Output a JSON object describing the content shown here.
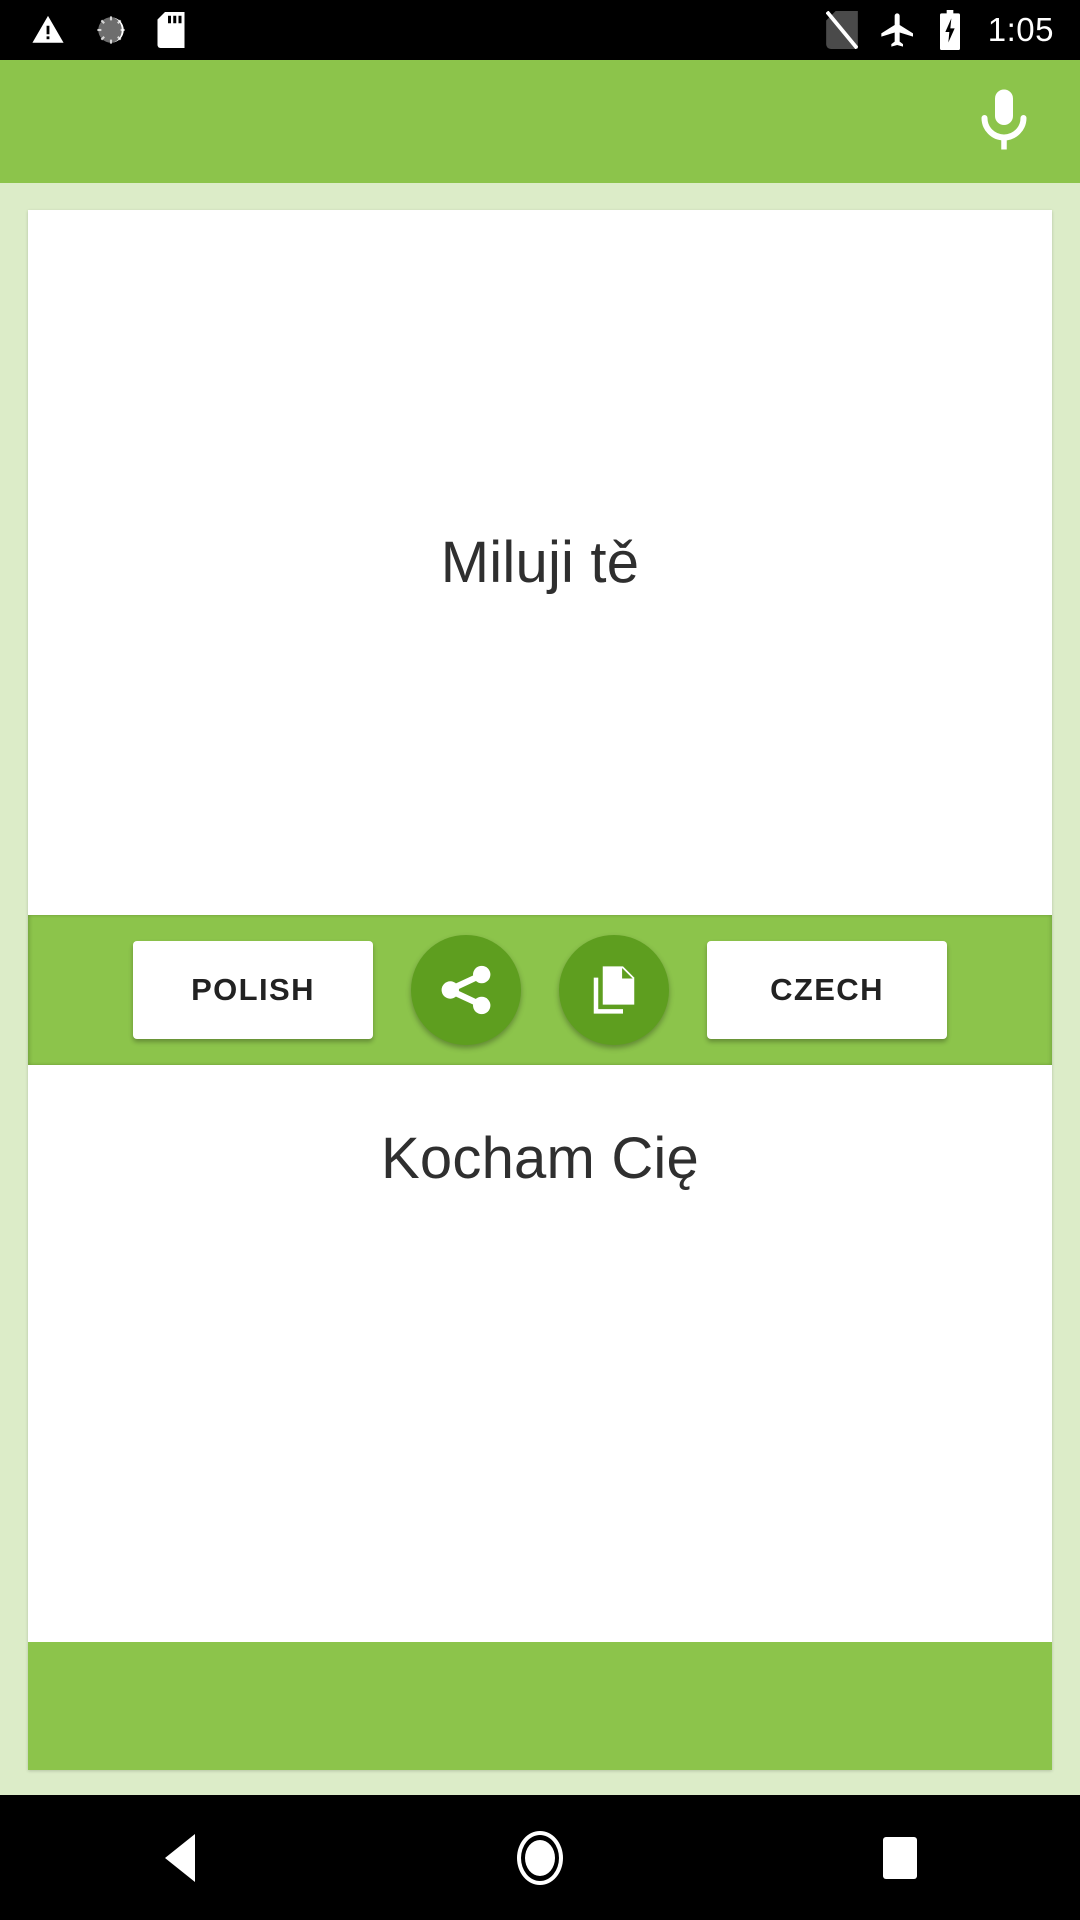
{
  "status_bar": {
    "icons_left": [
      {
        "name": "warning-icon",
        "label": "warning"
      },
      {
        "name": "sync-spinner-icon",
        "label": "sync"
      },
      {
        "name": "sd-card-icon",
        "label": "sd card"
      }
    ],
    "icons_right": [
      {
        "name": "no-sim-icon",
        "label": "no sim"
      },
      {
        "name": "airplane-mode-icon",
        "label": "airplane mode"
      },
      {
        "name": "battery-charging-icon",
        "label": "battery charging"
      }
    ],
    "time": "1:05",
    "background": "#000000",
    "foreground": "#ffffff"
  },
  "app_bar": {
    "title": "",
    "background": "#8cc44b",
    "mic_icon": "microphone-icon",
    "mic_label": "Voice input"
  },
  "theme": {
    "accent_green": "#8cc44b",
    "dark_green": "#5e9e1f",
    "page_background": "#dcecc8",
    "card_background": "#ffffff",
    "text_color": "#2f2f2f"
  },
  "translator": {
    "source": {
      "language_label": "POLISH",
      "text": "Miluji tě"
    },
    "target": {
      "language_label": "CZECH",
      "text": "Kocham Cię"
    },
    "actions": [
      {
        "name": "share-button",
        "icon": "share-icon",
        "label": "Share"
      },
      {
        "name": "copy-button",
        "icon": "copy-icon",
        "label": "Copy"
      }
    ]
  },
  "nav_bar": {
    "back_label": "Back",
    "home_label": "Home",
    "recents_label": "Recents",
    "background": "#000000"
  }
}
